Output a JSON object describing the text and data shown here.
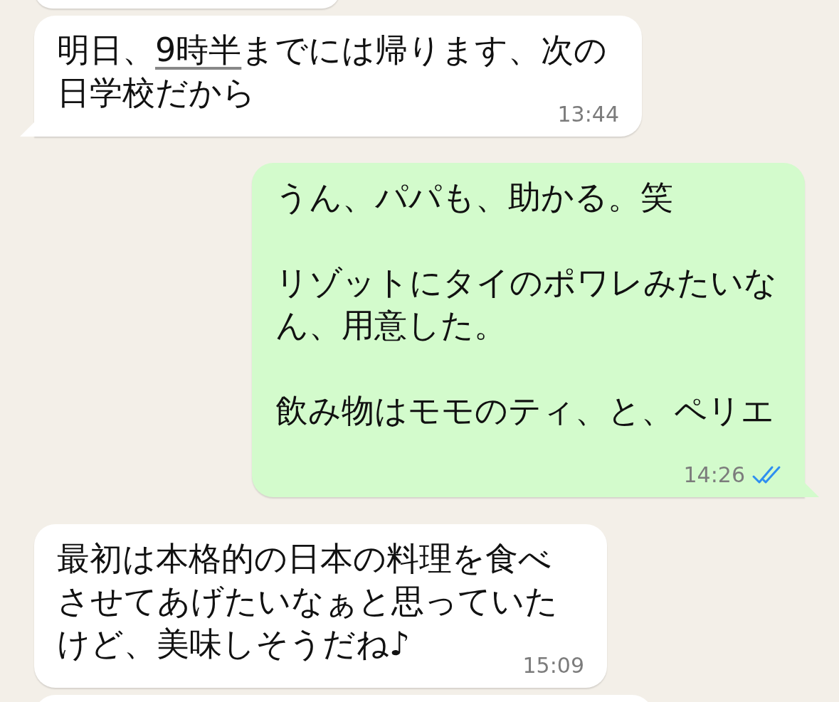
{
  "messages": [
    {
      "kind": "incoming",
      "tail": true,
      "paragraphs": [
        [
          {
            "text": "明日、"
          },
          {
            "text": "9時半",
            "link": true
          },
          {
            "text": "までには帰ります、次の日学校だから"
          }
        ]
      ],
      "time": "13:44"
    },
    {
      "kind": "outgoing",
      "tail": true,
      "paragraphs": [
        [
          {
            "text": "うん、パパも、助かる。笑"
          }
        ],
        [
          {
            "text": "リゾットにタイのポワレみたいなん、用意した。"
          }
        ],
        [
          {
            "text": "飲み物はモモのティ、と、ペリエ"
          }
        ]
      ],
      "time": "14:26",
      "read": true
    },
    {
      "kind": "incoming",
      "tail": false,
      "paragraphs": [
        [
          {
            "text": "最初は本格的の日本の料理を食べさせてあげたいなぁと思っていたけど、美味しそうだね♪"
          }
        ]
      ],
      "time": "15:09"
    }
  ]
}
